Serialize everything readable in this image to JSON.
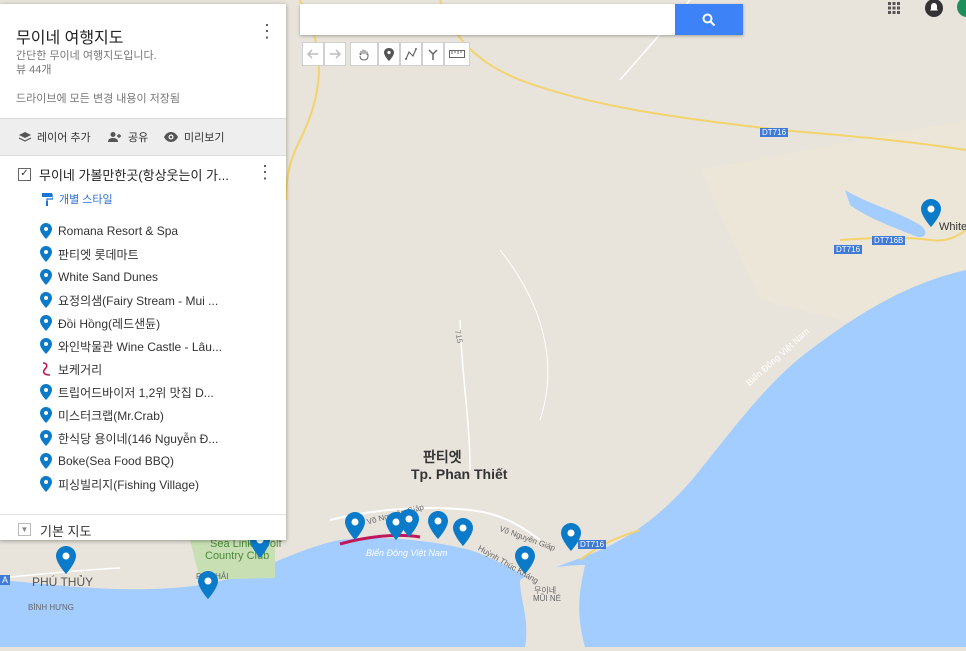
{
  "panel": {
    "title": "무이네 여행지도",
    "description": "간단한 무이네 여행지도입니다.",
    "views": "뷰 44개",
    "save_status": "드라이브에 모든 변경 내용이 저장됨",
    "toolbar": {
      "add_layer": "레이어 추가",
      "share": "공유",
      "preview": "미리보기"
    },
    "layer": {
      "name": "무이네 가볼만한곳(항상웃는이 가...",
      "style_link": "개별 스타일",
      "items": [
        {
          "label": "Romana Resort & Spa",
          "icon": "map-pin-icon"
        },
        {
          "label": "판티엣 롯데마트",
          "icon": "map-pin-icon"
        },
        {
          "label": "White Sand Dunes",
          "icon": "map-pin-icon"
        },
        {
          "label": "요정의샘(Fairy Stream - Mui ...",
          "icon": "map-pin-icon"
        },
        {
          "label": "Đồi Hồng(레드샌듄)",
          "icon": "map-pin-icon"
        },
        {
          "label": "와인박물관 Wine Castle - Lâu...",
          "icon": "map-pin-icon"
        },
        {
          "label": "보케거리",
          "icon": "line-path-icon"
        },
        {
          "label": "트립어드바이저 1,2위 맛집 D...",
          "icon": "map-pin-icon"
        },
        {
          "label": "미스터크랩(Mr.Crab)",
          "icon": "map-pin-icon"
        },
        {
          "label": "한식당 용이네(146 Nguyễn Đ...",
          "icon": "map-pin-icon"
        },
        {
          "label": "Boke(Sea Food BBQ)",
          "icon": "map-pin-icon"
        },
        {
          "label": "피싱빌리지(Fishing Village)",
          "icon": "map-pin-icon"
        }
      ]
    },
    "basemap_label": "기본 지도"
  },
  "search": {
    "placeholder": ""
  },
  "map": {
    "city_ko": "판티엣",
    "city_vi": "Tp. Phan Thiết",
    "sea_label_1": "Biển Đông Việt Nam",
    "sea_label_2": "Biển Đông Việt Nam",
    "road_1": "DT716",
    "road_2": "DT716",
    "road_3": "DT716B",
    "road_4": "DT716",
    "road_715": "715",
    "street_1": "Võ Nguyên Giáp",
    "street_2": "Võ Nguyên Giáp",
    "street_3": "Huỳnh Thúc Kháng",
    "poi_white": "White",
    "sea_links": "Sea Links Golf",
    "sea_links_2": "Country Club",
    "phu_thuy": "PHÚ THỦY",
    "binh_hung": "BÌNH HƯNG",
    "phu_hai": "PHÚ HẢI",
    "mui_ne_ko": "무이네",
    "mui_ne_vi": "MŨI NÉ",
    "a_label": "A"
  },
  "colors": {
    "accent": "#3e82f7",
    "pin": "#0b7bc9",
    "route": "#c2185b",
    "water": "#a3ccff",
    "land": "#e8e4dc"
  }
}
